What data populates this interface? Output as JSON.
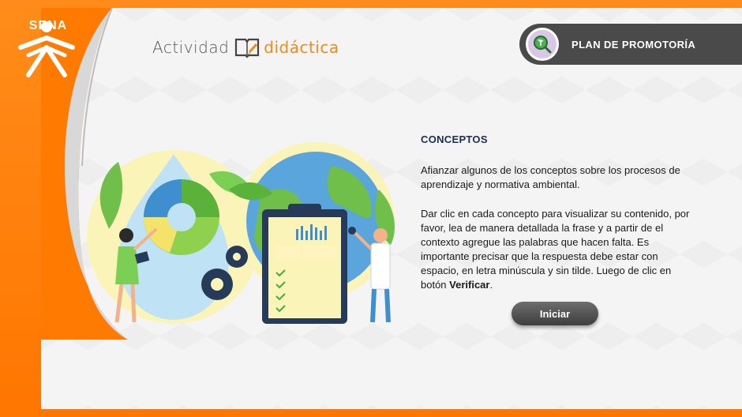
{
  "logo": {
    "text": "SENA"
  },
  "header": {
    "title_part1": "Actividad",
    "title_part2": "didáctica",
    "badge_label": "PLAN DE PROMOTORÍA"
  },
  "content": {
    "section_title": "CONCEPTOS",
    "paragraph1": "Afianzar algunos de los conceptos sobre los procesos de aprendizaje y normativa ambiental.",
    "paragraph2_before": "Dar clic en cada concepto para visualizar su contenido, por favor, lea de manera detallada la frase y a partir de el contexto agregue las palabras que hacen falta. Es importante precisar que la respuesta debe estar con espacio, en letra minúscula y sin tilde. Luego de clic en botón ",
    "paragraph2_bold": "Verificar",
    "paragraph2_after": "."
  },
  "actions": {
    "start_label": "Iniciar"
  },
  "colors": {
    "frame_orange": "#ff7a00",
    "title_orange": "#f28a1a",
    "badge_gray": "#4a4a4a",
    "heading_navy": "#1d2b5a"
  },
  "icons": {
    "logo": "sena-logo-icon",
    "title": "book-pencil-icon",
    "badge": "magnifier-plant-icon"
  }
}
